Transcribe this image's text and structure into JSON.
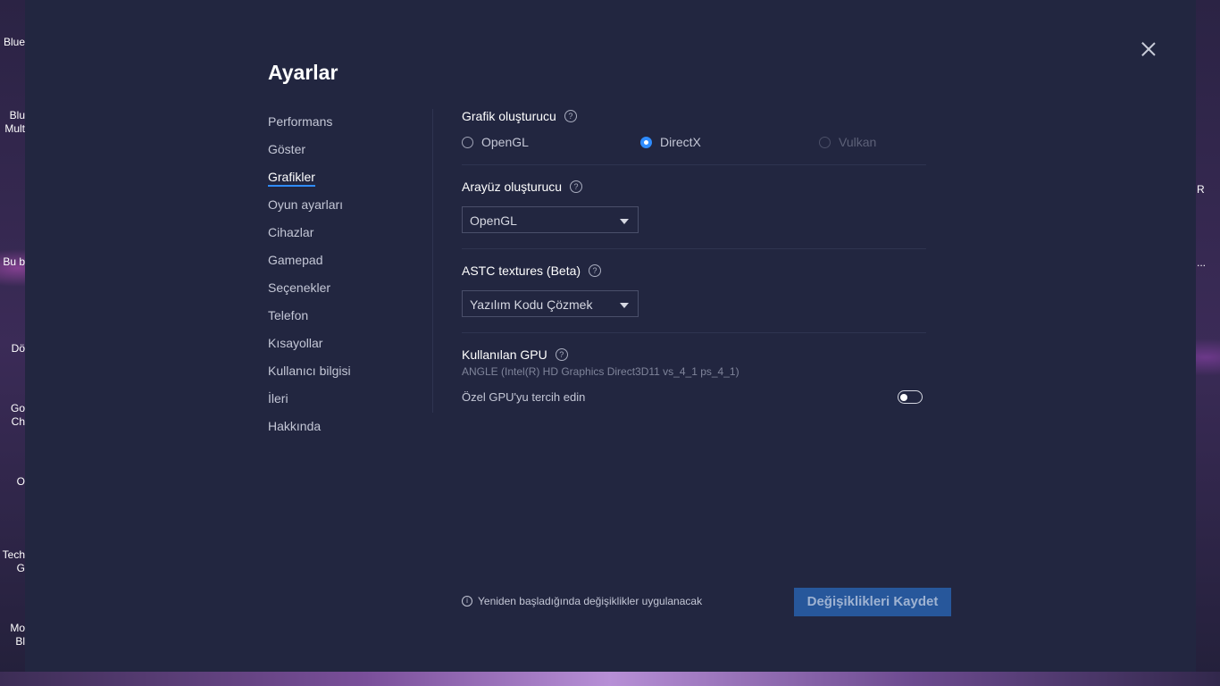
{
  "desktop": {
    "left_icons": [
      "Blue",
      "Blu",
      "Mult",
      "Bu b",
      "Dö",
      "Go",
      "Ch",
      "O",
      "Tech",
      "G",
      "Mo",
      "Bl"
    ],
    "right_icons": [
      "R",
      "..."
    ]
  },
  "settings": {
    "title": "Ayarlar",
    "nav": [
      {
        "label": "Performans"
      },
      {
        "label": "Göster"
      },
      {
        "label": "Grafikler",
        "active": true
      },
      {
        "label": "Oyun ayarları"
      },
      {
        "label": "Cihazlar"
      },
      {
        "label": "Gamepad"
      },
      {
        "label": "Seçenekler"
      },
      {
        "label": "Telefon"
      },
      {
        "label": "Kısayollar"
      },
      {
        "label": "Kullanıcı bilgisi"
      },
      {
        "label": "İleri"
      },
      {
        "label": "Hakkında"
      }
    ],
    "graphics_renderer": {
      "title": "Grafik oluşturucu",
      "options": [
        {
          "label": "OpenGL",
          "checked": false,
          "disabled": false
        },
        {
          "label": "DirectX",
          "checked": true,
          "disabled": false
        },
        {
          "label": "Vulkan",
          "checked": false,
          "disabled": true
        }
      ]
    },
    "interface_renderer": {
      "title": "Arayüz oluşturucu",
      "selected": "OpenGL"
    },
    "astc": {
      "title": "ASTC textures (Beta)",
      "selected": "Yazılım Kodu Çözmek"
    },
    "gpu": {
      "title": "Kullanılan GPU",
      "name": "ANGLE (Intel(R) HD Graphics Direct3D11 vs_4_1 ps_4_1)",
      "prefer_label": "Özel GPU'yu tercih edin",
      "prefer_enabled": false
    },
    "footer": {
      "info": "Yeniden başladığında değişiklikler uygulanacak",
      "save_label": "Değişiklikleri Kaydet"
    },
    "icons": {
      "help": "?",
      "info": "i"
    }
  }
}
